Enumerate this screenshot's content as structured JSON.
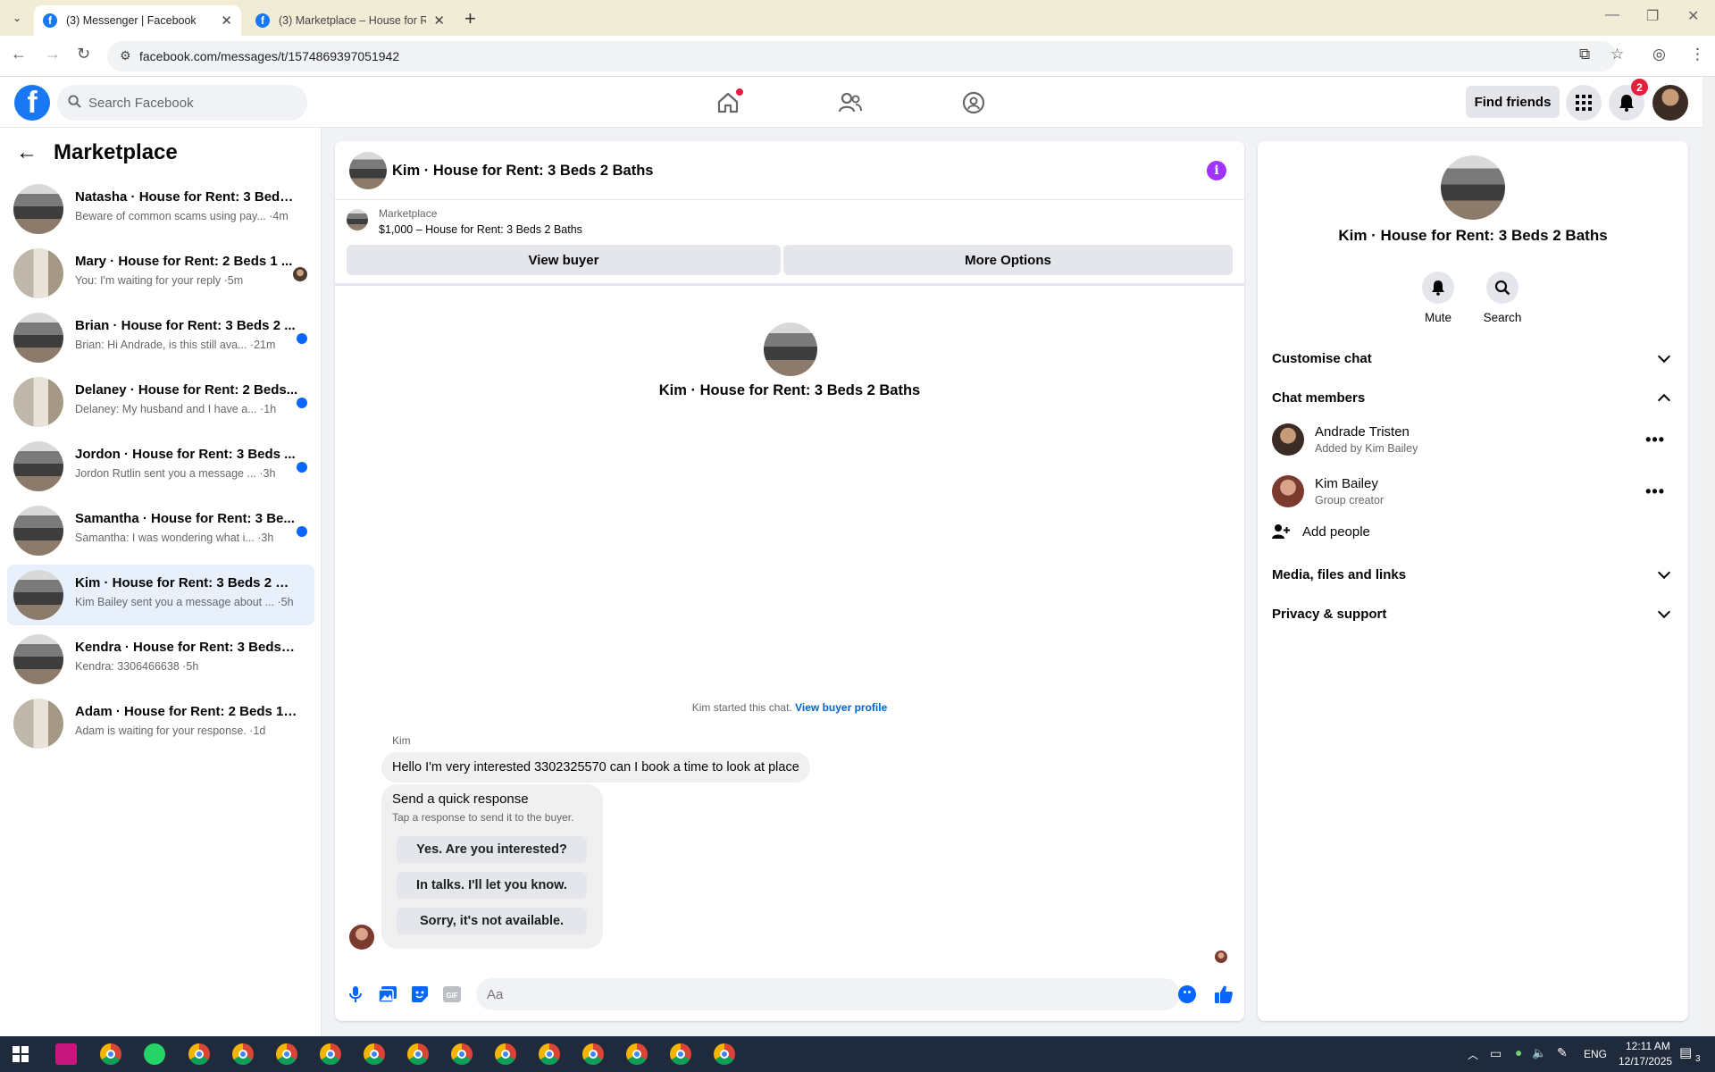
{
  "browser": {
    "tabs": [
      {
        "title": "(3) Messenger | Facebook",
        "active": true
      },
      {
        "title": "(3) Marketplace – House for Re...",
        "active": false
      }
    ],
    "url": "facebook.com/messages/t/1574869397051942"
  },
  "fb_header": {
    "search_placeholder": "Search Facebook",
    "find_friends": "Find friends",
    "notification_count": "2"
  },
  "sidebar": {
    "title": "Marketplace",
    "conversations": [
      {
        "name": "Natasha · House for Rent: 3 Beds 2...",
        "snippet": "Beware of common scams using pay... ·4m",
        "thumb": "kitchen",
        "status": "none"
      },
      {
        "name": "Mary · House for Rent: 2 Beds 1 ...",
        "snippet": "You: I'm waiting for your reply ·5m",
        "thumb": "bath",
        "status": "seen"
      },
      {
        "name": "Brian · House for Rent: 3 Beds 2 ...",
        "snippet": "Brian: Hi Andrade, is this still ava... ·21m",
        "thumb": "kitchen",
        "status": "unread"
      },
      {
        "name": "Delaney · House for Rent: 2 Beds...",
        "snippet": "Delaney: My husband and I have a... ·1h",
        "thumb": "bath",
        "status": "unread"
      },
      {
        "name": "Jordon · House for Rent: 3 Beds ...",
        "snippet": "Jordon Rutlin sent you a message ... ·3h",
        "thumb": "kitchen",
        "status": "unread"
      },
      {
        "name": "Samantha · House for Rent: 3 Be...",
        "snippet": "Samantha: I was wondering what i... ·3h",
        "thumb": "kitchen",
        "status": "unread"
      },
      {
        "name": "Kim · House for Rent: 3 Beds 2 Baths",
        "snippet": "Kim Bailey sent you a message about ... ·5h",
        "thumb": "kitchen",
        "status": "none",
        "active": true
      },
      {
        "name": "Kendra · House for Rent: 3 Beds 2 ...",
        "snippet": "Kendra: 3306466638 ·5h",
        "thumb": "kitchen",
        "status": "none"
      },
      {
        "name": "Adam · House for Rent: 2 Beds 1 B...",
        "snippet": "Adam is waiting for your response. ·1d",
        "thumb": "bath",
        "status": "none"
      }
    ]
  },
  "chat": {
    "title": "Kim · House for Rent: 3 Beds 2 Baths",
    "marketplace_label": "Marketplace",
    "listing": "$1,000 – House for Rent: 3 Beds 2 Baths",
    "view_buyer": "View buyer",
    "more_options": "More Options",
    "intro_title": "Kim · House for Rent: 3 Beds 2 Baths",
    "started_text": "Kim started this chat.",
    "view_buyer_profile": "View buyer profile",
    "sender_name": "Kim",
    "message": "Hello I'm very interested 3302325570 can I book a time to look at place",
    "quick_title": "Send a quick response",
    "quick_subtitle": "Tap a response to send it to the buyer.",
    "quick_responses": [
      "Yes. Are you interested?",
      "In talks. I'll let you know.",
      "Sorry, it's not available."
    ],
    "input_placeholder": "Aa"
  },
  "details": {
    "title": "Kim · House for Rent: 3 Beds 2 Baths",
    "mute": "Mute",
    "search": "Search",
    "customise_chat": "Customise chat",
    "chat_members": "Chat members",
    "members": [
      {
        "name": "Andrade Tristen",
        "sub": "Added by Kim Bailey"
      },
      {
        "name": "Kim Bailey",
        "sub": "Group creator"
      }
    ],
    "add_people": "Add people",
    "media": "Media, files and links",
    "privacy": "Privacy & support"
  },
  "taskbar": {
    "time": "12:11 AM",
    "date": "12/17/2025",
    "lang": "ENG",
    "notif": "3"
  },
  "colors": {
    "fb_blue": "#1877f2",
    "messenger_blue": "#0866ff",
    "unread": "#0866ff",
    "info_purple": "#a033ff",
    "notif_red": "#e41e3f"
  }
}
